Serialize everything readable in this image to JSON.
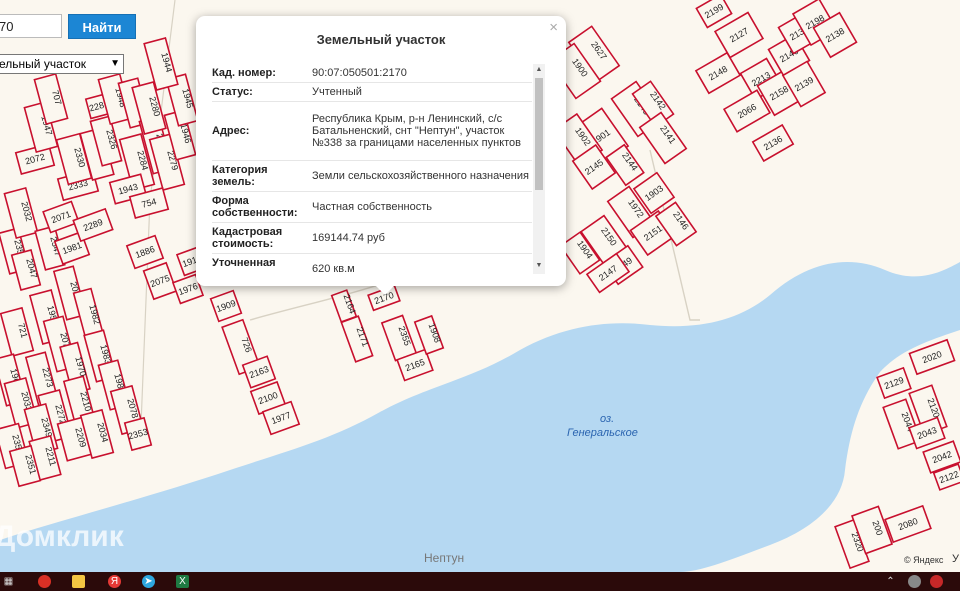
{
  "search": {
    "value": "70",
    "button_label": "Найти"
  },
  "layer_select": {
    "selected": "ельный участок"
  },
  "popup": {
    "title": "Земельный участок",
    "close": "×",
    "rows": [
      {
        "key": "Кад. номер:",
        "value": "90:07:050501:2170"
      },
      {
        "key": "Статус:",
        "value": "Учтенный"
      },
      {
        "key": "Адрес:",
        "value": "Республика Крым, р-н Ленинский, с/с Батальненский, снт \"Нептун\", участок №338 за границами населенных пунктов"
      },
      {
        "key": "Категория земель:",
        "value": "Земли сельскохозяйственного назначения"
      },
      {
        "key": "Форма собственности:",
        "value": "Частная собственность"
      },
      {
        "key": "Кадастровая стоимость:",
        "value": "169144.74 руб"
      },
      {
        "key": "Уточненная площадь:",
        "value": "620 кв.м"
      }
    ]
  },
  "map": {
    "lake_label_1": "оз.",
    "lake_label_2": "Генеральское",
    "place_label": "Нептун",
    "watermark": "Домклик",
    "copyright": "© Яндекс",
    "copyright_link": "У",
    "colors": {
      "plot_border": "#c8102e",
      "water": "#b5d8f2",
      "land": "#fbf7ef"
    }
  },
  "plots": [
    {
      "label": "2170"
    },
    {
      "label": "2355"
    },
    {
      "label": "2165"
    },
    {
      "label": "1908"
    },
    {
      "label": "2171"
    },
    {
      "label": "2164"
    },
    {
      "label": "1909"
    },
    {
      "label": "726"
    },
    {
      "label": "2163"
    },
    {
      "label": "2100"
    },
    {
      "label": "1977"
    },
    {
      "label": "1886"
    },
    {
      "label": "2075"
    },
    {
      "label": "1976"
    },
    {
      "label": "1910"
    },
    {
      "label": "2030"
    },
    {
      "label": "1982"
    },
    {
      "label": "1983"
    },
    {
      "label": "1984"
    },
    {
      "label": "2078"
    },
    {
      "label": "1958"
    },
    {
      "label": "2077"
    },
    {
      "label": "1970"
    },
    {
      "label": "2273"
    },
    {
      "label": "2272"
    },
    {
      "label": "2210"
    },
    {
      "label": "2209"
    },
    {
      "label": "2034"
    },
    {
      "label": "2353"
    },
    {
      "label": "721"
    },
    {
      "label": "1967"
    },
    {
      "label": "2033"
    },
    {
      "label": "2349"
    },
    {
      "label": "2350"
    },
    {
      "label": "2211"
    },
    {
      "label": "2351"
    },
    {
      "label": "2352"
    },
    {
      "label": "2047"
    },
    {
      "label": "2032"
    },
    {
      "label": "2347"
    },
    {
      "label": "1981"
    },
    {
      "label": "2071"
    },
    {
      "label": "2289"
    },
    {
      "label": "2072"
    },
    {
      "label": "2333"
    },
    {
      "label": "1947"
    },
    {
      "label": "2330"
    },
    {
      "label": "2288"
    },
    {
      "label": "2326"
    },
    {
      "label": "2287"
    },
    {
      "label": "707"
    },
    {
      "label": "1948"
    },
    {
      "label": "2285"
    },
    {
      "label": "2284"
    },
    {
      "label": "2281"
    },
    {
      "label": "2280"
    },
    {
      "label": "2279"
    },
    {
      "label": "1946"
    },
    {
      "label": "1945"
    },
    {
      "label": "1944"
    },
    {
      "label": "1943"
    },
    {
      "label": "754"
    },
    {
      "label": "2627"
    },
    {
      "label": "1900"
    },
    {
      "label": "1901"
    },
    {
      "label": "1902"
    },
    {
      "label": "2145"
    },
    {
      "label": "2144"
    },
    {
      "label": "2143"
    },
    {
      "label": "2142"
    },
    {
      "label": "2141"
    },
    {
      "label": "1972"
    },
    {
      "label": "1903"
    },
    {
      "label": "2151"
    },
    {
      "label": "2146"
    },
    {
      "label": "2150"
    },
    {
      "label": "1904"
    },
    {
      "label": "2149"
    },
    {
      "label": "2147"
    },
    {
      "label": "2148"
    },
    {
      "label": "2127"
    },
    {
      "label": "2213"
    },
    {
      "label": "2066"
    },
    {
      "label": "2158"
    },
    {
      "label": "2140"
    },
    {
      "label": "2139"
    },
    {
      "label": "2130"
    },
    {
      "label": "2198"
    },
    {
      "label": "2138"
    },
    {
      "label": "2136"
    },
    {
      "label": "2199"
    },
    {
      "label": "2129"
    },
    {
      "label": "2020"
    },
    {
      "label": "2120"
    },
    {
      "label": "2044"
    },
    {
      "label": "2043"
    },
    {
      "label": "2042"
    },
    {
      "label": "2122"
    },
    {
      "label": "2320"
    },
    {
      "label": "200"
    },
    {
      "label": "2080"
    },
    {
      "label": "2319"
    },
    {
      "label": "2123"
    }
  ],
  "taskbar": {
    "icons": [
      "windows-icon",
      "chrome-icon",
      "explorer-icon",
      "yandex-icon",
      "telegram-icon",
      "excel-icon",
      "chevron-up-icon",
      "speaker-icon",
      "tray-icon"
    ]
  }
}
